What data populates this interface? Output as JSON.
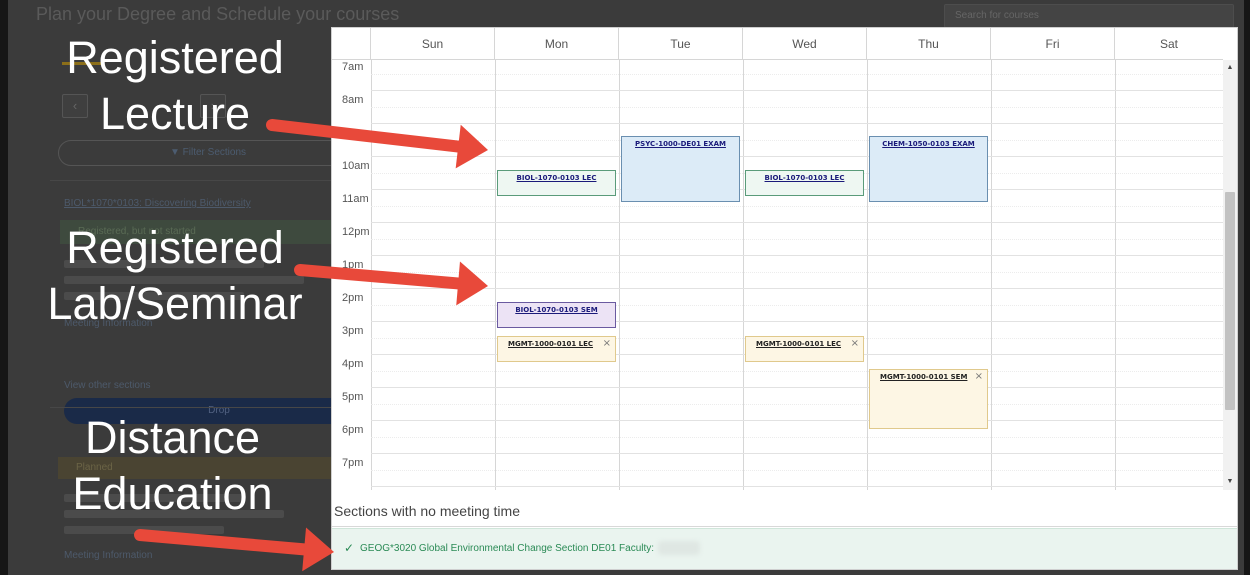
{
  "background": {
    "header_title": "Plan your Degree and Schedule your courses",
    "search_placeholder": "Search for courses",
    "filter_label": "Filter Sections",
    "course_link": "BIOL*1070*0103: Discovering Biodiversity",
    "status_label": "Registered, but not started",
    "meeting_info_label": "Meeting Information",
    "drop_button": "Drop",
    "view_other_sections": "View other sections",
    "planned_label": "Planned",
    "meeting_info_label_2": "Meeting Information"
  },
  "calendar": {
    "days": [
      "Sun",
      "Mon",
      "Tue",
      "Wed",
      "Thu",
      "Fri",
      "Sat"
    ],
    "times": [
      "7am",
      "8am",
      "",
      "10am",
      "11am",
      "12pm",
      "1pm",
      "2pm",
      "3pm",
      "4pm",
      "5pm",
      "6pm",
      "7pm"
    ],
    "events": [
      {
        "label": "BIOL-1070-0103 LEC",
        "type": "lec"
      },
      {
        "label": "PSYC-1000-DE01 EXAM",
        "type": "exam"
      },
      {
        "label": "BIOL-1070-0103 LEC",
        "type": "lec"
      },
      {
        "label": "CHEM-1050-0103 EXAM",
        "type": "exam"
      },
      {
        "label": "BIOL-1070-0103 SEM",
        "type": "sem"
      },
      {
        "label": "MGMT-1000-0101 LEC",
        "type": "planned"
      },
      {
        "label": "MGMT-1000-0101 LEC",
        "type": "planned"
      },
      {
        "label": "MGMT-1000-0101 SEM",
        "type": "planned"
      }
    ],
    "remove_icon": "×",
    "no_meeting_title": "Sections with no meeting time",
    "no_meeting_section": "GEOG*3020 Global Environmental Change Section DE01 Faculty:",
    "check_icon": "✓"
  },
  "annotations": {
    "registered_lecture": [
      "Registered",
      "Lecture"
    ],
    "registered_lab": [
      "Registered",
      "Lab/Seminar"
    ],
    "distance_education": [
      "Distance",
      "Education"
    ],
    "arrow_color": "#e8493a"
  },
  "colors": {
    "lecture_fill": "#eef7f2",
    "exam_fill": "#dcebf7",
    "seminar_fill": "#ece3f5",
    "planned_fill": "#fdf6e4",
    "registered_green": "#2a8a55"
  }
}
